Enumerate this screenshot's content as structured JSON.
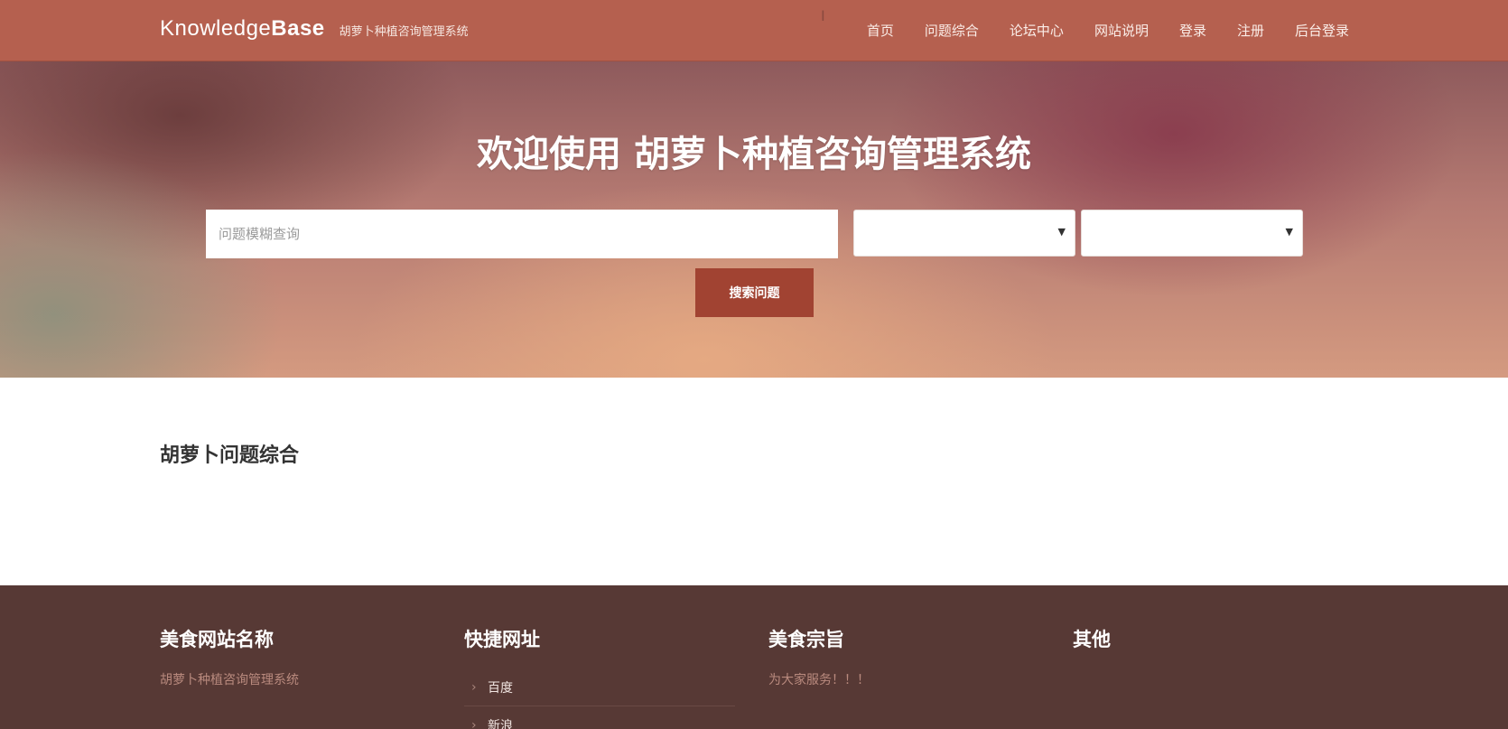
{
  "header": {
    "brand_light": "Knowledge",
    "brand_bold": "Base",
    "subtitle": "胡萝卜种植咨询管理系统",
    "nav": [
      "首页",
      "问题综合",
      "论坛中心",
      "网站说明",
      "登录",
      "注册",
      "后台登录"
    ]
  },
  "hero": {
    "title": "欢迎使用 胡萝卜种植咨询管理系统",
    "search_placeholder": "问题模糊查询",
    "select_one_value": "",
    "select_two_value": "",
    "search_button": "搜索问题"
  },
  "main": {
    "section_title": "胡萝卜问题综合"
  },
  "footer": {
    "col1_heading": "美食网站名称",
    "col1_text": "胡萝卜种植咨询管理系统",
    "col2_heading": "快捷网址",
    "col2_links": [
      "百度",
      "新浪"
    ],
    "col3_heading": "美食宗旨",
    "col3_text": "为大家服务！！！",
    "col4_heading": "其他"
  },
  "colors": {
    "navbar": "#b5604f",
    "accent_button": "#a14332",
    "footer_bg": "#573935"
  }
}
